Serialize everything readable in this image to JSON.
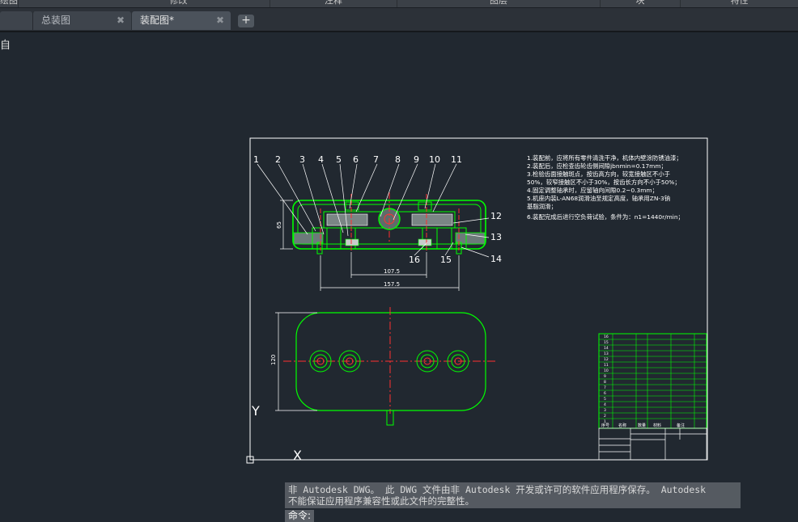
{
  "ribbon": {
    "panels": [
      "绘图",
      "修改",
      "注释",
      "图层",
      "块",
      "特性"
    ]
  },
  "tabs": {
    "overview_label": "总装图",
    "drawing_label": "装配图*",
    "close_glyph": "✖",
    "add_glyph": "+"
  },
  "viewport": {
    "label": "自"
  },
  "drawing": {
    "part_numbers_top": [
      "1",
      "2",
      "3",
      "4",
      "5",
      "6",
      "7",
      "8",
      "9",
      "10",
      "11"
    ],
    "part_numbers_right": [
      "12",
      "13",
      "14"
    ],
    "part_numbers_bottom": [
      "16",
      "15"
    ],
    "dim_height_front": "65",
    "dim_inner": "107.5",
    "dim_outer": "157.5",
    "dim_height_top": "120",
    "tech_requirements": [
      "1.装配前，应将所有零件清洗干净，机体内壁涂防锈油漆；",
      "2.装配后，应检查齿轮齿侧间隙jbnmin=0.17mm；",
      "3.检验齿面接触斑点，按齿高方向，较宽接触区不小于",
      "50%，较窄接触区不小于30%，按齿长方向不小于50%；",
      "4.固定调整轴承时，应留轴向间隙0.2~0.3mm；",
      "5.机座内装L-AN68润滑油至规定高度，轴承用ZN-3钠",
      "基脂润滑；",
      "6.装配完成后进行空负荷试验，条件为：n1=1440r/min；"
    ],
    "parts_table_rows": [
      "16",
      "15",
      "14",
      "13",
      "12",
      "11",
      "10",
      "9",
      "8",
      "7",
      "6",
      "5",
      "4",
      "3",
      "2",
      "1"
    ],
    "parts_table_header": [
      "序号",
      "名称",
      "数量",
      "材料",
      "备注"
    ]
  },
  "ucs": {
    "y_label": "Y",
    "x_label": "X"
  },
  "command": {
    "history_line1": "非 Autodesk DWG。  此 DWG 文件由非 Autodesk 开发或许可的软件应用程序保存。  Autodesk",
    "history_line2": "不能保证应用程序兼容性或此文件的完整性。",
    "prompt": "命令:"
  }
}
